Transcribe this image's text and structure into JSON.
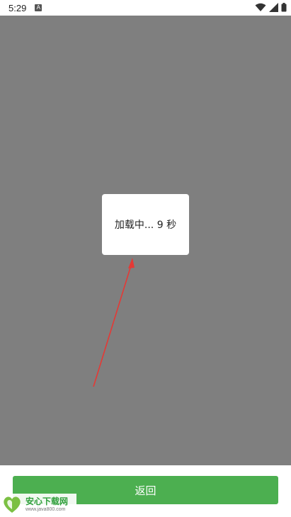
{
  "status_bar": {
    "time": "5:29",
    "icons": [
      "a-notification-icon",
      "wifi-icon",
      "signal-icon",
      "battery-icon"
    ]
  },
  "dialog": {
    "text": "加载中... 9 秒"
  },
  "bottom": {
    "back_label": "返回"
  },
  "watermark": {
    "title": "安心下载网",
    "url": "www.java800.com"
  },
  "colors": {
    "overlay": "#7f7f7f",
    "button": "#4caf50",
    "annotation_arrow": "#e53935"
  }
}
